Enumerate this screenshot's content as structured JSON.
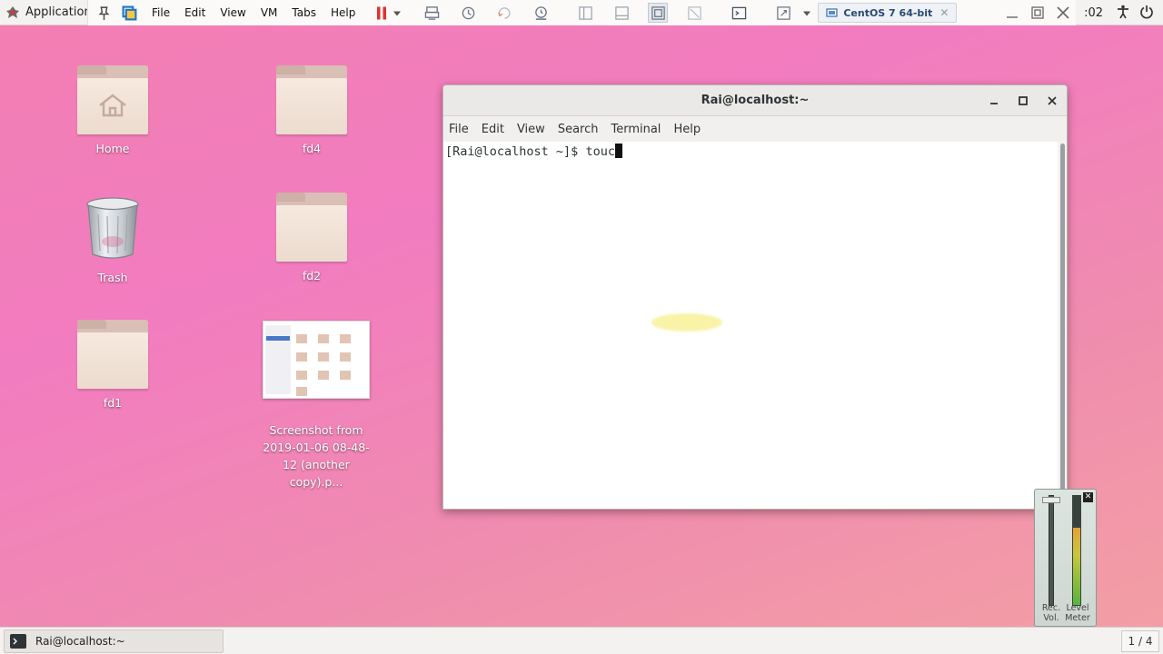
{
  "topbar": {
    "applications_label": "Application",
    "clock": ":02",
    "icons": [
      "applications-icon",
      "pin-icon",
      "vmware-icon",
      "accessibility-icon",
      "power-icon"
    ]
  },
  "vm_toolbar": {
    "menus": [
      "File",
      "Edit",
      "View",
      "VM",
      "Tabs",
      "Help"
    ],
    "pause_color": "#e0312f",
    "tab_label": "CentOS 7 64-bit",
    "icons": [
      "pause-icon",
      "dropdown-icon",
      "send-keys-icon",
      "snapshot-icon",
      "revert-icon",
      "snapshot-manager-icon",
      "library-icon",
      "single-window-icon",
      "fullscreen-icon",
      "unity-icon",
      "console-icon",
      "stretch-icon",
      "tab-close-icon",
      "minimize-icon",
      "restore-icon",
      "close-icon"
    ]
  },
  "desktop": {
    "icons": [
      {
        "name": "Home",
        "type": "home-folder"
      },
      {
        "name": "fd4",
        "type": "folder"
      },
      {
        "name": "Trash",
        "type": "trash"
      },
      {
        "name": "fd2",
        "type": "folder"
      },
      {
        "name": "fd1",
        "type": "folder"
      },
      {
        "name": "Screenshot from\n2019-01-06 08-48-\n12 (another copy).p...",
        "type": "image"
      }
    ]
  },
  "terminal": {
    "title": "Rai@localhost:~",
    "menu": [
      "File",
      "Edit",
      "View",
      "Search",
      "Terminal",
      "Help"
    ],
    "prompt": "[Rai@localhost ~]$ ",
    "input": "touc"
  },
  "level_widget": {
    "rec_label": "Rec.\nVol.",
    "meter_label": "Level\nMeter",
    "rec_volume_fraction": 0.98,
    "meter_fraction": 0.72
  },
  "taskbar": {
    "task_label": "Rai@localhost:~",
    "workspace": "1 / 4"
  }
}
